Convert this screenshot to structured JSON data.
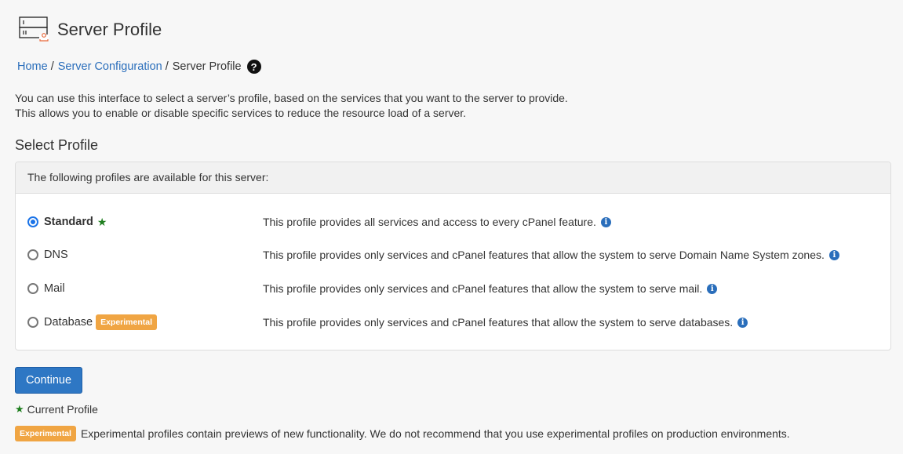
{
  "header": {
    "title": "Server Profile",
    "icon": "server-profile-icon"
  },
  "breadcrumb": {
    "items": [
      {
        "label": "Home",
        "link": true
      },
      {
        "label": "Server Configuration",
        "link": true
      },
      {
        "label": "Server Profile",
        "link": false
      }
    ],
    "separator": "/",
    "help_icon": "?"
  },
  "intro": {
    "line1": "You can use this interface to select a server’s profile, based on the services that you want to the server to provide.",
    "line2": "This allows you to enable or disable specific services to reduce the resource load of a server."
  },
  "section_title": "Select Profile",
  "panel": {
    "heading": "The following profiles are available for this server:",
    "profiles": [
      {
        "name": "Standard",
        "selected": true,
        "current": true,
        "badge": null,
        "description": "This profile provides all services and access to every cPanel feature."
      },
      {
        "name": "DNS",
        "selected": false,
        "current": false,
        "badge": null,
        "description": "This profile provides only services and cPanel features that allow the system to serve Domain Name System zones."
      },
      {
        "name": "Mail",
        "selected": false,
        "current": false,
        "badge": null,
        "description": "This profile provides only services and cPanel features that allow the system to serve mail."
      },
      {
        "name": "Database",
        "selected": false,
        "current": false,
        "badge": "Experimental",
        "description": "This profile provides only services and cPanel features that allow the system to serve databases."
      }
    ]
  },
  "continue_label": "Continue",
  "legend": {
    "current_profile": "Current Profile",
    "experimental_badge": "Experimental",
    "experimental_note": "Experimental profiles contain previews of new functionality. We do not recommend that you use experimental profiles on production environments."
  },
  "glyphs": {
    "star": "★",
    "info": "i"
  },
  "colors": {
    "link": "#2a6ebb",
    "primary_button": "#2e77c4",
    "badge": "#f0a543",
    "star": "#1f7f1f",
    "radio_selected": "#1a73e8"
  }
}
